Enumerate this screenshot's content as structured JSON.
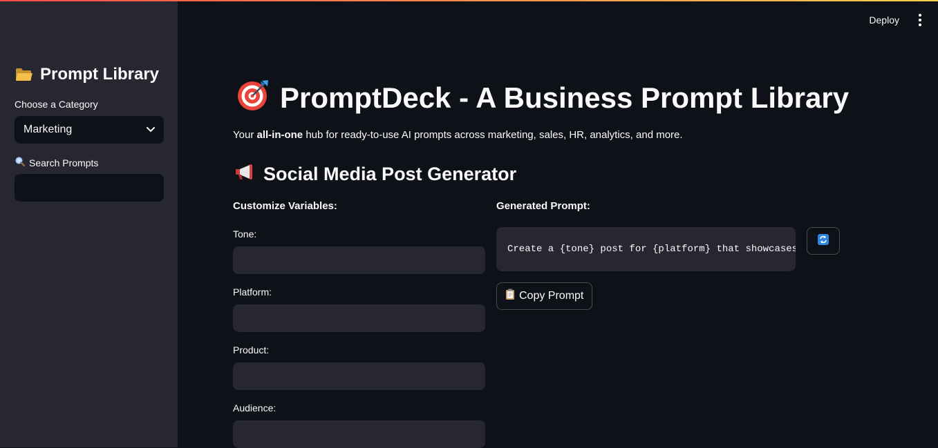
{
  "header": {
    "deploy_label": "Deploy",
    "menu_icon": "kebab-menu-icon"
  },
  "sidebar": {
    "title": "Prompt Library",
    "title_icon": "folder-icon",
    "category_label": "Choose a Category",
    "category_value": "Marketing",
    "search_label": "Search Prompts",
    "search_icon": "magnifier-icon",
    "search_value": "",
    "search_placeholder": ""
  },
  "main": {
    "title": "PromptDeck - A Business Prompt Library",
    "title_icon": "target-icon",
    "subtitle_prefix": "Your ",
    "subtitle_bold": "all-in-one",
    "subtitle_suffix": " hub for ready-to-use AI prompts across marketing, sales, HR, analytics, and more.",
    "section_title": "Social Media Post Generator",
    "section_icon": "megaphone-icon",
    "variables_heading": "Customize Variables:",
    "variables": [
      {
        "label": "Tone:",
        "value": ""
      },
      {
        "label": "Platform:",
        "value": ""
      },
      {
        "label": "Product:",
        "value": ""
      },
      {
        "label": "Audience:",
        "value": ""
      }
    ],
    "generated_heading": "Generated Prompt:",
    "generated_prompt": "Create a {tone} post for {platform} that showcases",
    "refresh_icon": "refresh-icon",
    "copy_label": "Copy Prompt",
    "copy_icon": "clipboard-icon"
  },
  "colors": {
    "background": "#0e1117",
    "sidebar": "#262730",
    "input": "#262730",
    "text": "#fafafa",
    "accent": "#ff4b4b"
  }
}
